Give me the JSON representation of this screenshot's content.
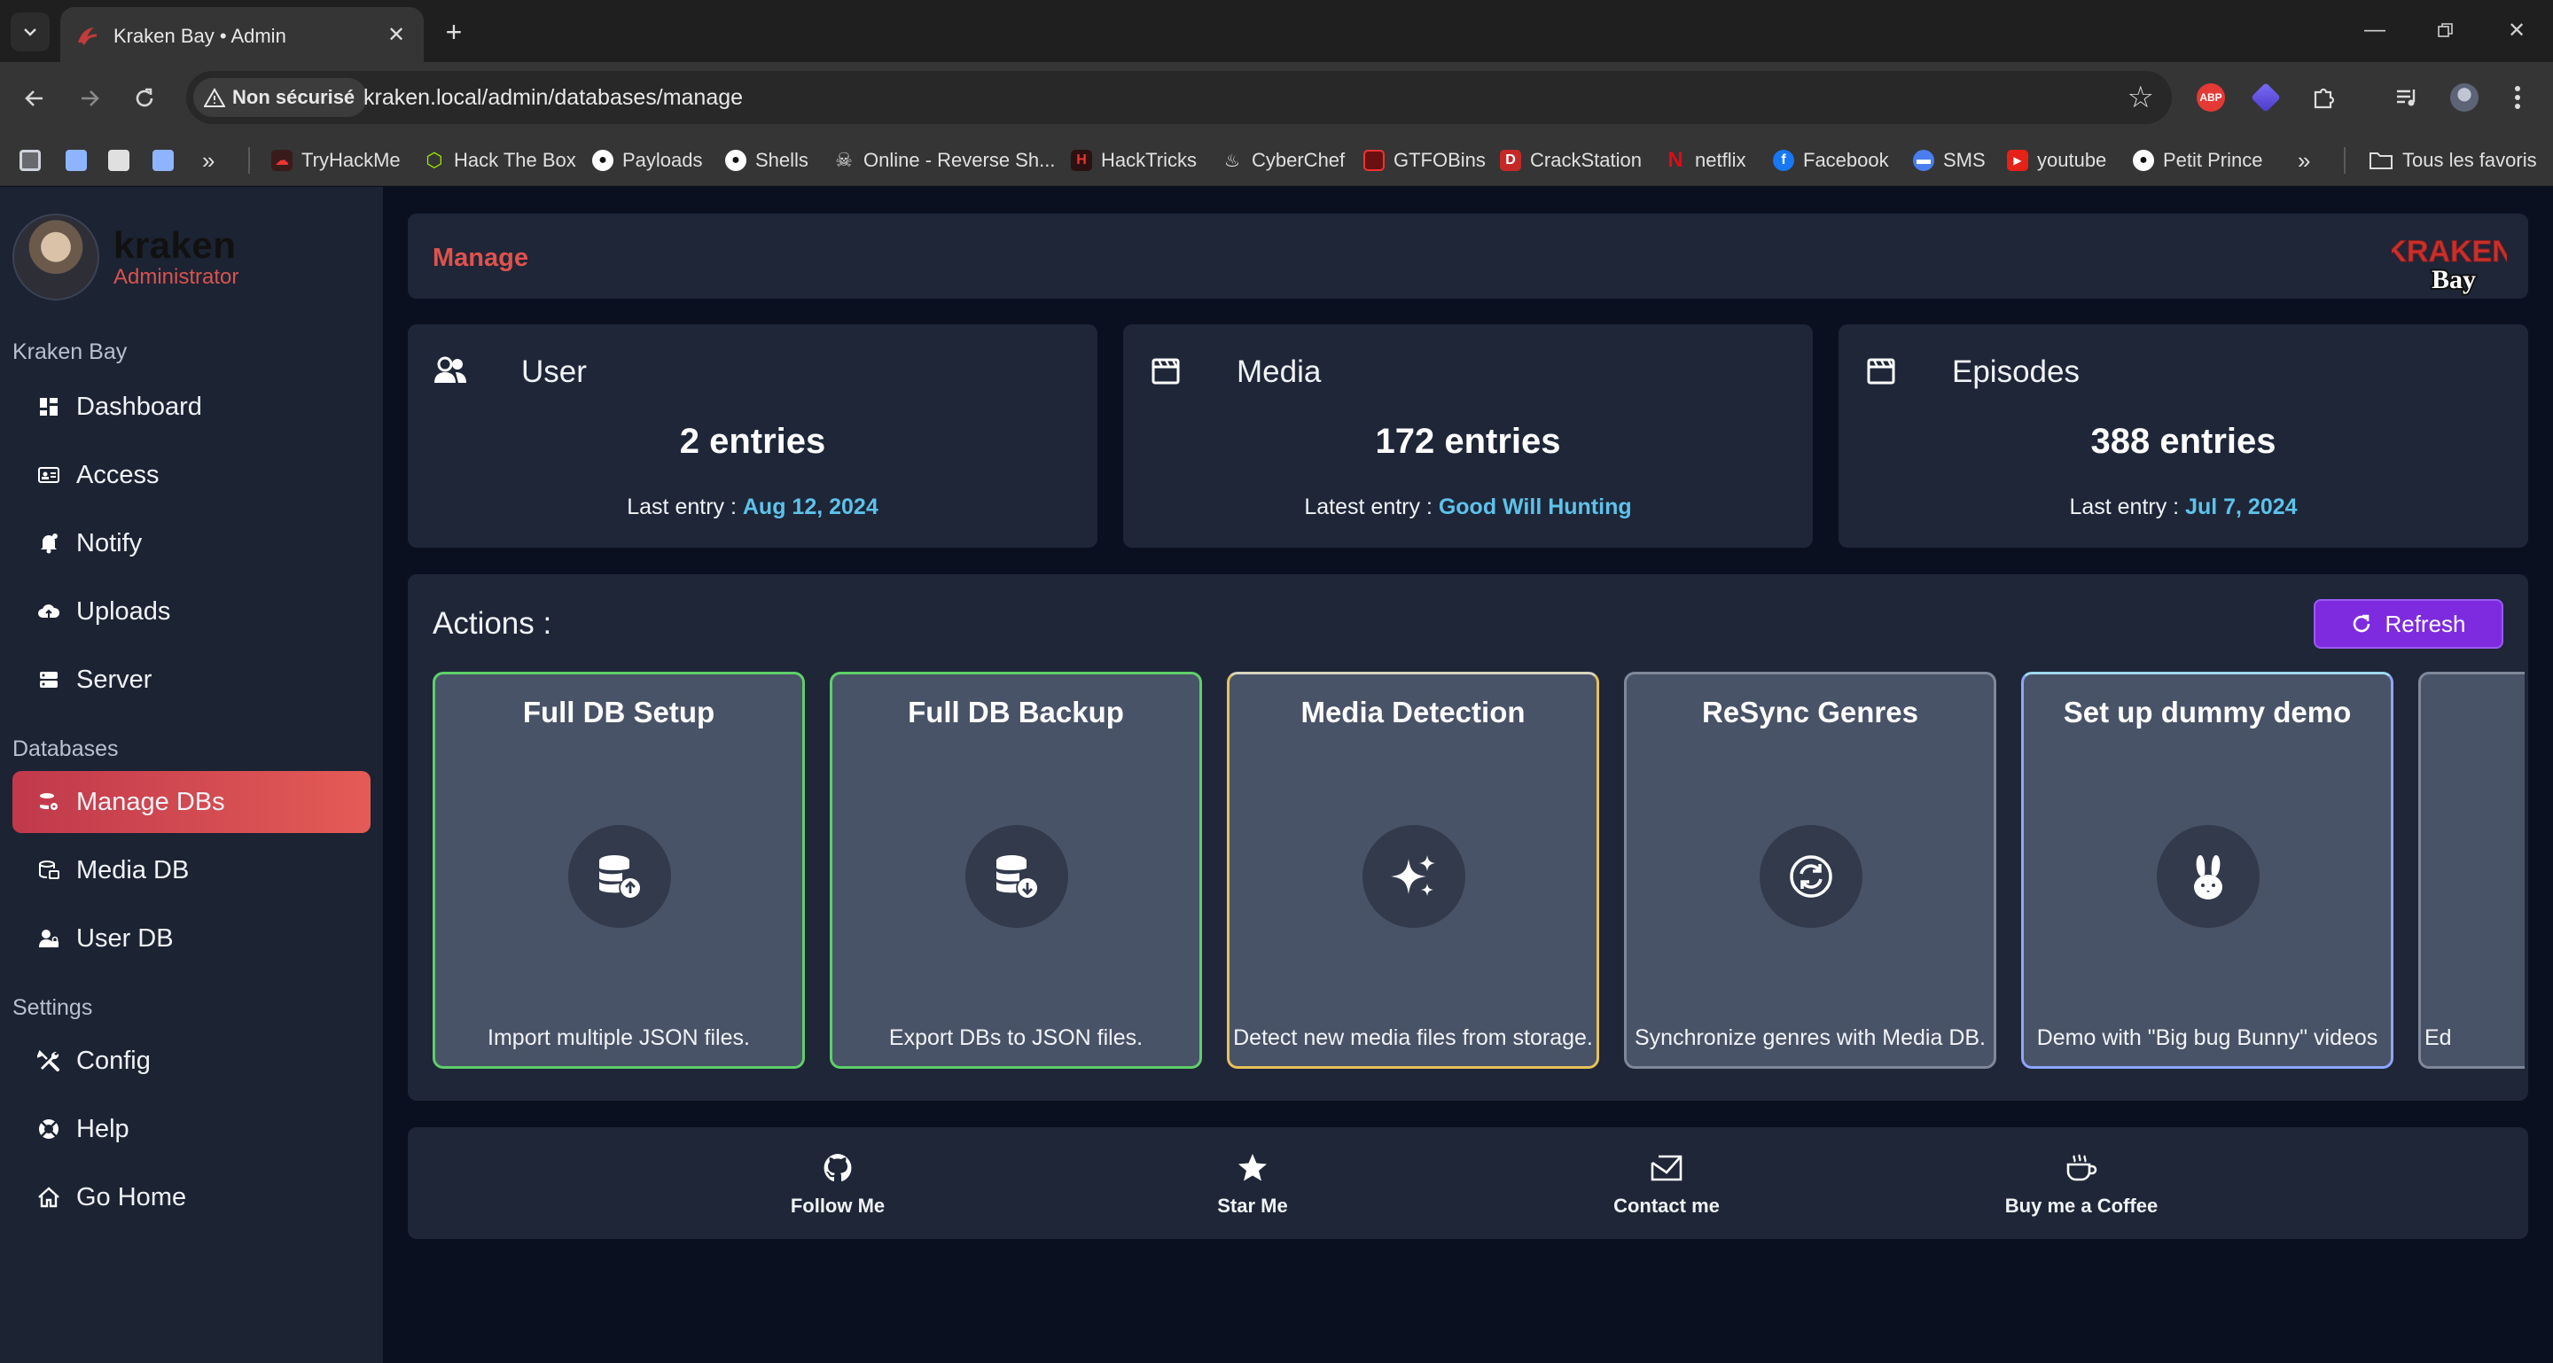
{
  "browser": {
    "tab_title": "Kraken Bay • Admin",
    "security_chip": "Non sécurisé",
    "url": "kraken.local/admin/databases/manage",
    "bookmarks": [
      {
        "label": "TryHackMe"
      },
      {
        "label": "Hack The Box"
      },
      {
        "label": "Payloads"
      },
      {
        "label": "Shells"
      },
      {
        "label": "Online - Reverse Sh..."
      },
      {
        "label": "HackTricks"
      },
      {
        "label": "CyberChef"
      },
      {
        "label": "GTFOBins"
      },
      {
        "label": "CrackStation"
      },
      {
        "label": "netflix"
      },
      {
        "label": "Facebook"
      },
      {
        "label": "SMS"
      },
      {
        "label": "youtube"
      },
      {
        "label": "Petit Prince"
      }
    ],
    "all_bookmarks": "Tous les favoris",
    "extensions": {
      "abp": "ABP"
    }
  },
  "sidebar": {
    "user_name": "kraken",
    "user_role": "Administrator",
    "sections": [
      {
        "title": "Kraken Bay",
        "items": [
          {
            "label": "Dashboard",
            "icon": "dashboard-icon"
          },
          {
            "label": "Access",
            "icon": "id-card-icon"
          },
          {
            "label": "Notify",
            "icon": "bell-icon"
          },
          {
            "label": "Uploads",
            "icon": "cloud-upload-icon"
          },
          {
            "label": "Server",
            "icon": "server-icon"
          }
        ]
      },
      {
        "title": "Databases",
        "items": [
          {
            "label": "Manage DBs",
            "icon": "database-gear-icon",
            "active": true
          },
          {
            "label": "Media DB",
            "icon": "database-media-icon"
          },
          {
            "label": "User DB",
            "icon": "user-lock-icon"
          }
        ]
      },
      {
        "title": "Settings",
        "items": [
          {
            "label": "Config",
            "icon": "tools-icon"
          },
          {
            "label": "Help",
            "icon": "lifebuoy-icon"
          },
          {
            "label": "Go Home",
            "icon": "home-icon"
          }
        ]
      }
    ]
  },
  "header": {
    "title": "Manage",
    "logo_top": "KRAKEN",
    "logo_bottom": "Bay"
  },
  "stats": [
    {
      "title": "User",
      "value": "2 entries",
      "foot_label": "Last entry : ",
      "foot_value": "Aug 12, 2024",
      "icon": "users-icon"
    },
    {
      "title": "Media",
      "value": "172 entries",
      "foot_label": "Latest entry : ",
      "foot_value": "Good Will Hunting",
      "icon": "clapperboard-icon"
    },
    {
      "title": "Episodes",
      "value": "388 entries",
      "foot_label": "Last entry : ",
      "foot_value": "Jul 7, 2024",
      "icon": "clapperboard-icon"
    }
  ],
  "actions": {
    "title": "Actions :",
    "refresh_label": "Refresh",
    "cards": [
      {
        "title": "Full DB Setup",
        "desc": "Import multiple JSON files.",
        "icon": "database-upload-icon",
        "border": "#5fcf6a"
      },
      {
        "title": "Full DB Backup",
        "desc": "Export DBs to JSON files.",
        "icon": "database-download-icon",
        "border": "#5fcf6a"
      },
      {
        "title": "Media Detection",
        "desc": "Detect new media files from storage.",
        "icon": "sparkles-icon",
        "border": "#e8c25a"
      },
      {
        "title": "ReSync Genres",
        "desc": "Synchronize genres with Media DB.",
        "icon": "sync-icon",
        "border": "#7f889a"
      },
      {
        "title": "Set up dummy demo",
        "desc": "Demo with \"Big bug Bunny\" videos",
        "icon": "rabbit-icon",
        "border": "#8ea5ff"
      },
      {
        "title": "",
        "desc": "Ed",
        "icon": "",
        "border": "#7f889a"
      }
    ]
  },
  "footer": [
    {
      "label": "Follow Me",
      "icon": "github-icon"
    },
    {
      "label": "Star Me",
      "icon": "star-icon"
    },
    {
      "label": "Contact me",
      "icon": "mail-icon"
    },
    {
      "label": "Buy me a Coffee",
      "icon": "coffee-icon"
    }
  ],
  "colors": {
    "accent_red": "#e0524c",
    "link_blue": "#5ec2ea",
    "refresh_purple": "#7e2be0"
  }
}
